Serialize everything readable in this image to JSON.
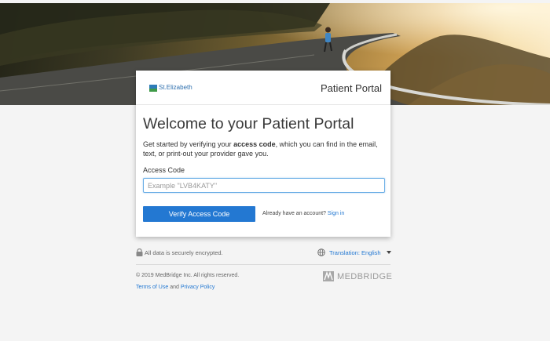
{
  "header": {
    "logo_text": "St.Elizabeth",
    "portal_title": "Patient Portal"
  },
  "main": {
    "welcome_title": "Welcome to your Patient Portal",
    "intro_prefix": "Get started by verifying your ",
    "intro_bold": "access code",
    "intro_suffix": ", which you can find in the email, text, or print-out your provider gave you.",
    "access_code_label": "Access Code",
    "access_code_value": "",
    "access_code_placeholder": "Example \"LVB4KATY\"",
    "verify_button": "Verify Access Code",
    "have_account_text": "Already have an account?",
    "sign_in_link": "Sign in"
  },
  "footer": {
    "secure_text": "All data is securely encrypted.",
    "translation_label": "Translation: English",
    "copyright": "© 2019 MedBridge Inc. All rights reserved.",
    "terms_link": "Terms of Use",
    "and_text": "and",
    "privacy_link": "Privacy Policy",
    "brand_logo_text": "MEDBRIDGE"
  },
  "icons": {
    "lock": "lock-icon",
    "globe": "globe-icon",
    "caret": "caret-down-icon",
    "medbridge": "medbridge-logo-icon"
  },
  "colors": {
    "accent": "#2378d2",
    "input_focus": "#6aaee6",
    "page_bg": "#f4f4f4"
  }
}
